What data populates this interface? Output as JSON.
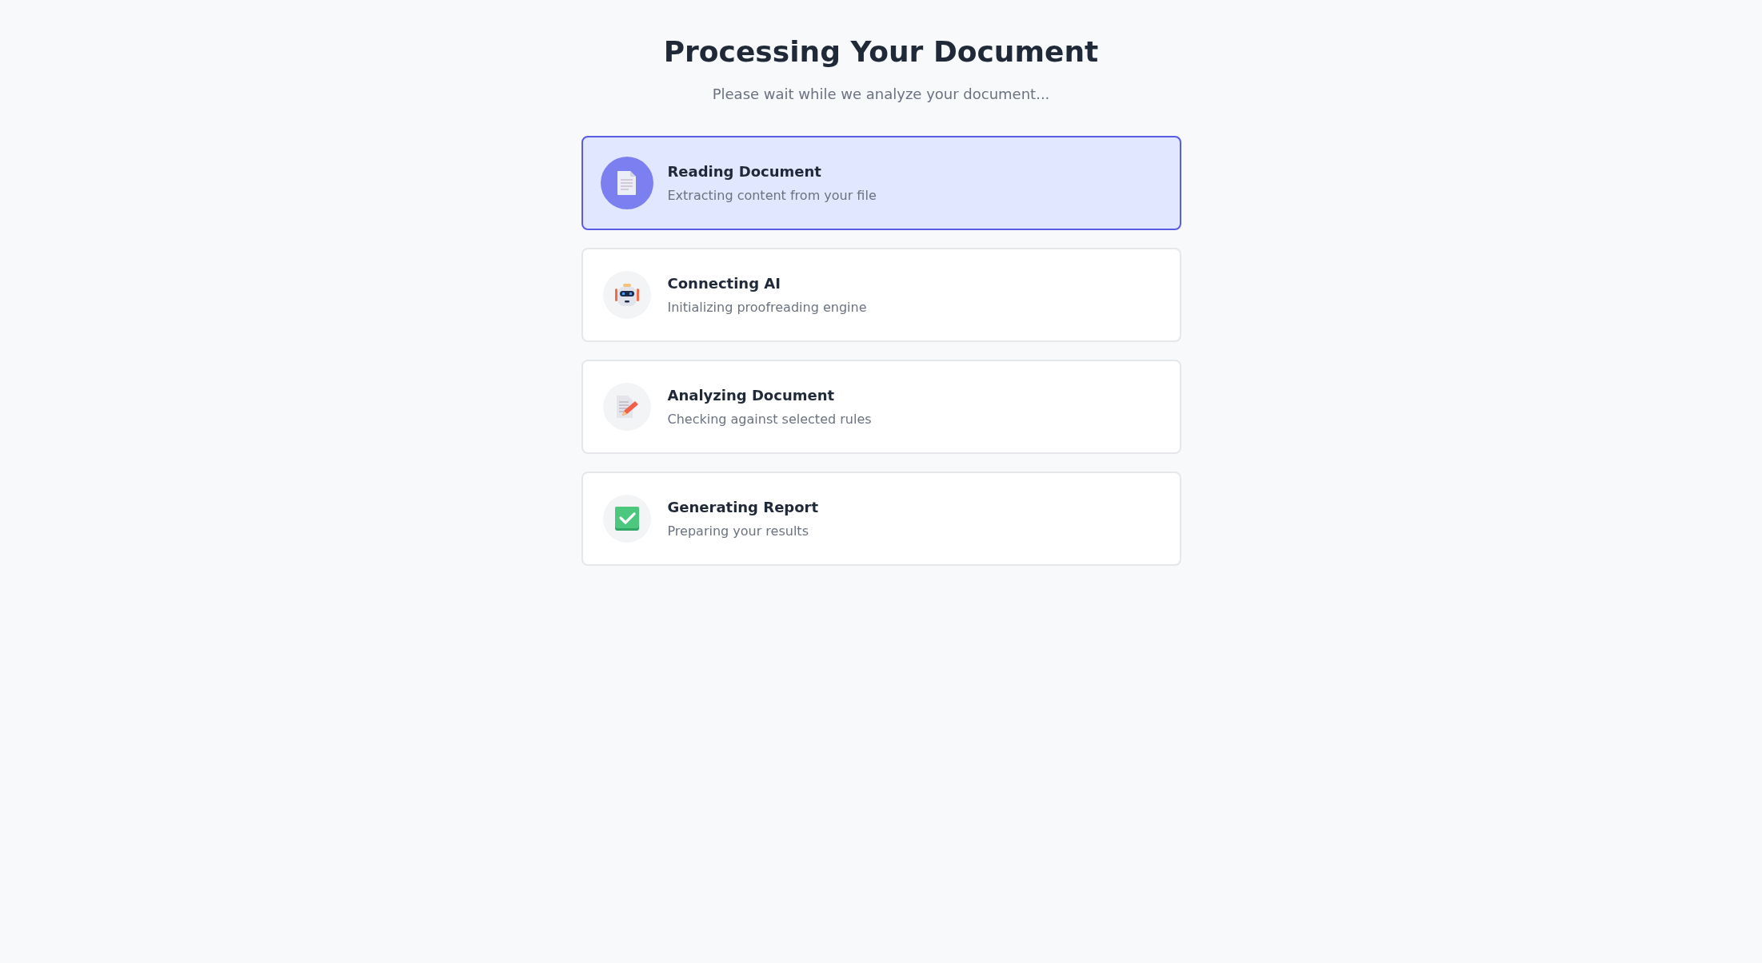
{
  "title": "Processing Your Document",
  "subtitle": "Please wait while we analyze your document...",
  "steps": [
    {
      "kind": "document",
      "title": "Reading Document",
      "description": "Extracting content from your file",
      "selected": true
    },
    {
      "kind": "robot",
      "title": "Connecting AI",
      "description": "Initializing proofreading engine",
      "selected": false
    },
    {
      "kind": "edit",
      "title": "Analyzing Document",
      "description": "Checking against selected rules",
      "selected": false
    },
    {
      "kind": "check",
      "title": "Generating Report",
      "description": "Preparing your results",
      "selected": false
    }
  ]
}
